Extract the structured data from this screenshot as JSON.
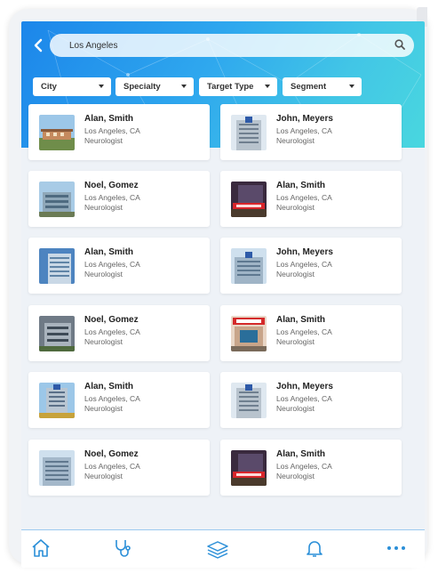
{
  "search": {
    "value": "Los Angeles"
  },
  "filters": [
    "City",
    "Specialty",
    "Target Type",
    "Segment"
  ],
  "doctors": [
    {
      "name": "Alan, Smith",
      "location": "Los Angeles, CA",
      "specialty": "Neurologist"
    },
    {
      "name": "John, Meyers",
      "location": "Los Angeles, CA",
      "specialty": "Neurologist"
    },
    {
      "name": "Noel, Gomez",
      "location": "Los Angeles, CA",
      "specialty": "Neurologist"
    },
    {
      "name": "Alan, Smith",
      "location": "Los Angeles, CA",
      "specialty": "Neurologist"
    },
    {
      "name": "Alan, Smith",
      "location": "Los Angeles, CA",
      "specialty": "Neurologist"
    },
    {
      "name": "John, Meyers",
      "location": "Los Angeles, CA",
      "specialty": "Neurologist"
    },
    {
      "name": "Noel, Gomez",
      "location": "Los Angeles, CA",
      "specialty": "Neurologist"
    },
    {
      "name": "Alan, Smith",
      "location": "Los Angeles, CA",
      "specialty": "Neurologist"
    },
    {
      "name": "Alan, Smith",
      "location": "Los Angeles, CA",
      "specialty": "Neurologist"
    },
    {
      "name": "John, Meyers",
      "location": "Los Angeles, CA",
      "specialty": "Neurologist"
    },
    {
      "name": "Noel, Gomez",
      "location": "Los Angeles, CA",
      "specialty": "Neurologist"
    },
    {
      "name": "Alan, Smith",
      "location": "Los Angeles, CA",
      "specialty": "Neurologist"
    }
  ],
  "tabs": [
    "home-icon",
    "stethoscope-icon",
    "books-icon",
    "bell-icon",
    "more-icon"
  ],
  "colors": {
    "accent": "#1c86ea",
    "tab_icon": "#2b8fd8"
  }
}
